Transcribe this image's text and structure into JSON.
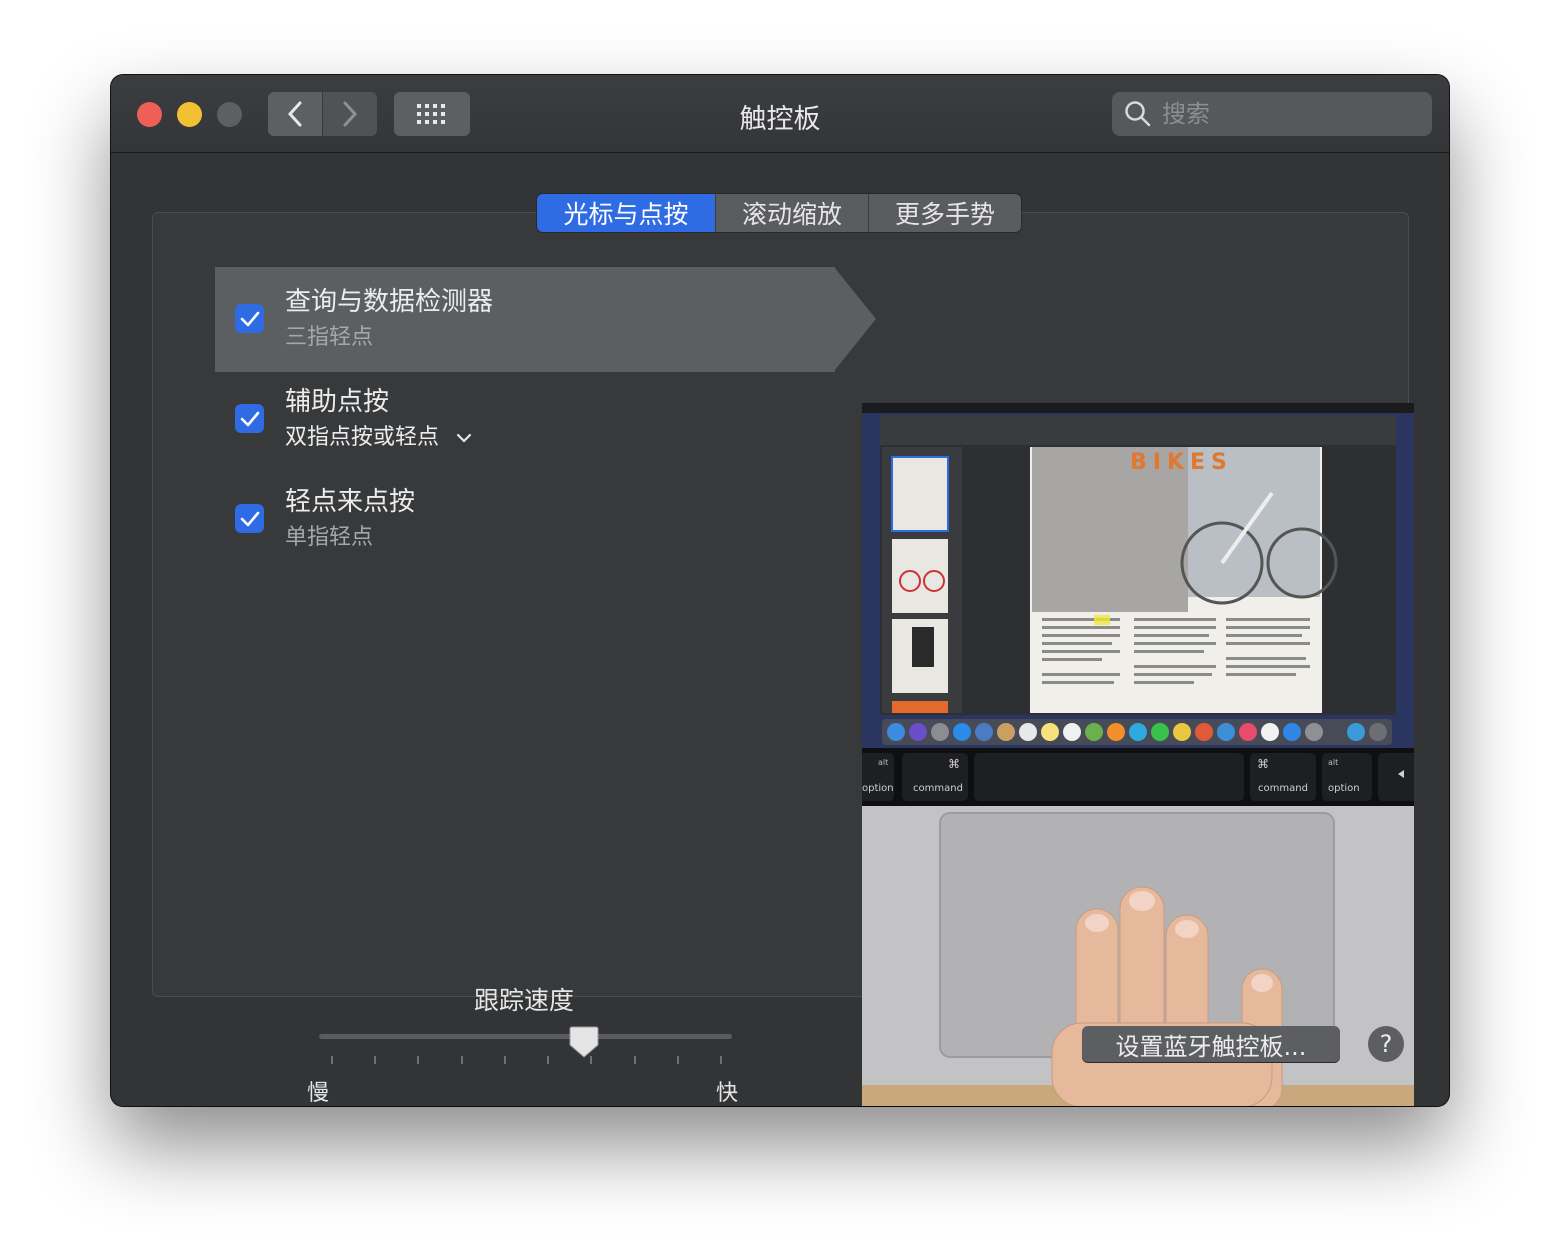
{
  "window": {
    "title": "触控板",
    "search_placeholder": "搜索"
  },
  "tabs": [
    {
      "label": "光标与点按",
      "active": true
    },
    {
      "label": "滚动缩放",
      "active": false
    },
    {
      "label": "更多手势",
      "active": false
    }
  ],
  "options": [
    {
      "title": "查询与数据检测器",
      "subtitle": "三指轻点",
      "checked": true
    },
    {
      "title": "辅助点按",
      "subtitle": "双指点按或轻点",
      "checked": true
    },
    {
      "title": "轻点来点按",
      "subtitle": "单指轻点",
      "checked": true
    }
  ],
  "tracking": {
    "label": "跟踪速度",
    "min_label": "慢",
    "max_label": "快",
    "ticks": 10,
    "value_fraction": 0.65
  },
  "preview": {
    "keys": {
      "option": "option",
      "command": "command",
      "alt": "alt",
      "cmd_symbol": "⌘"
    },
    "doc_heading": "BIKES"
  },
  "footer": {
    "bluetooth_button": "设置蓝牙触控板...",
    "help_button": "?"
  },
  "colors": {
    "accent": "#2f6be3",
    "window_bg": "#323436",
    "close": "#ed5f57",
    "minimize": "#f1c033"
  }
}
